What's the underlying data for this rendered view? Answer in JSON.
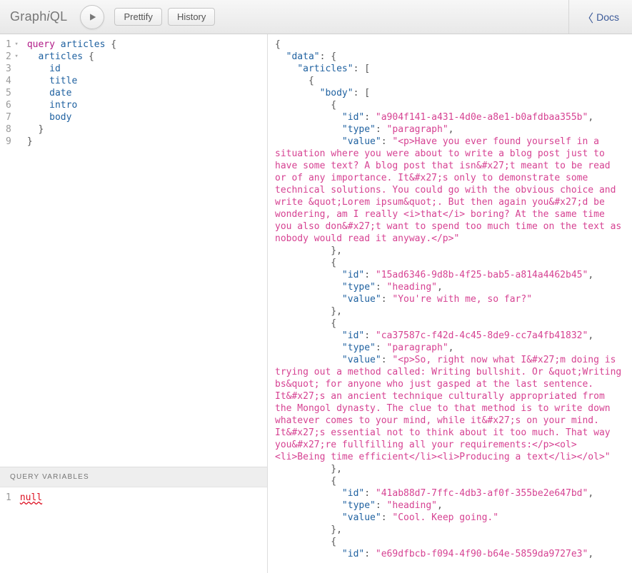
{
  "logo_prefix": "Graph",
  "logo_i": "i",
  "logo_suffix": "QL",
  "toolbar": {
    "prettify": "Prettify",
    "history": "History",
    "docs": "Docs"
  },
  "query": {
    "lines": [
      {
        "n": 1,
        "fold": true,
        "tokens": [
          [
            "kw",
            "query"
          ],
          [
            "",
            ""
          ],
          [
            "sp",
            " "
          ],
          [
            "def",
            "articles"
          ],
          [
            "sp",
            " "
          ],
          [
            "punc",
            "{"
          ]
        ]
      },
      {
        "n": 2,
        "fold": true,
        "tokens": [
          [
            "sp",
            "  "
          ],
          [
            "attr",
            "articles"
          ],
          [
            "sp",
            " "
          ],
          [
            "punc",
            "{"
          ]
        ]
      },
      {
        "n": 3,
        "tokens": [
          [
            "sp",
            "    "
          ],
          [
            "attr",
            "id"
          ]
        ]
      },
      {
        "n": 4,
        "tokens": [
          [
            "sp",
            "    "
          ],
          [
            "attr",
            "title"
          ]
        ]
      },
      {
        "n": 5,
        "tokens": [
          [
            "sp",
            "    "
          ],
          [
            "attr",
            "date"
          ]
        ]
      },
      {
        "n": 6,
        "tokens": [
          [
            "sp",
            "    "
          ],
          [
            "attr",
            "intro"
          ]
        ]
      },
      {
        "n": 7,
        "tokens": [
          [
            "sp",
            "    "
          ],
          [
            "attr",
            "body"
          ]
        ]
      },
      {
        "n": 8,
        "tokens": [
          [
            "sp",
            "  "
          ],
          [
            "punc",
            "}"
          ]
        ]
      },
      {
        "n": 9,
        "tokens": [
          [
            "punc",
            "}"
          ]
        ]
      }
    ]
  },
  "variables": {
    "header": "Query Variables",
    "line_no": "1",
    "value": "null"
  },
  "result_rows": [
    {
      "indent": 0,
      "parts": [
        [
          "punc",
          "{"
        ]
      ]
    },
    {
      "indent": 1,
      "parts": [
        [
          "key",
          "\"data\""
        ],
        [
          "punc",
          ": {"
        ]
      ]
    },
    {
      "indent": 2,
      "parts": [
        [
          "key",
          "\"articles\""
        ],
        [
          "punc",
          ": ["
        ]
      ]
    },
    {
      "indent": 3,
      "parts": [
        [
          "punc",
          "{"
        ]
      ]
    },
    {
      "indent": 4,
      "parts": [
        [
          "key",
          "\"body\""
        ],
        [
          "punc",
          ": ["
        ]
      ]
    },
    {
      "indent": 5,
      "parts": [
        [
          "punc",
          "{"
        ]
      ]
    },
    {
      "indent": 6,
      "parts": [
        [
          "key",
          "\"id\""
        ],
        [
          "punc",
          ": "
        ],
        [
          "str",
          "\"a904f141-a431-4d0e-a8e1-b0afdbaa355b\""
        ],
        [
          "punc",
          ","
        ]
      ]
    },
    {
      "indent": 6,
      "parts": [
        [
          "key",
          "\"type\""
        ],
        [
          "punc",
          ": "
        ],
        [
          "str",
          "\"paragraph\""
        ],
        [
          "punc",
          ","
        ]
      ]
    },
    {
      "indent": 6,
      "wrap": true,
      "parts": [
        [
          "key",
          "\"value\""
        ],
        [
          "punc",
          ": "
        ],
        [
          "str",
          "\"<p>Have you ever found yourself in a situation where you were about to write a blog post just to have some text? A blog post that isn&#x27;t meant to be read or of any importance. It&#x27;s only to demonstrate some technical solutions. You could go with the obvious choice and write &quot;Lorem ipsum&quot;. But then again you&#x27;d be wondering, am I really <i>that</i> boring? At the same time you also don&#x27;t want to spend too much time on the text as nobody would read it anyway.</p>\""
        ]
      ]
    },
    {
      "indent": 5,
      "parts": [
        [
          "punc",
          "},"
        ]
      ]
    },
    {
      "indent": 5,
      "parts": [
        [
          "punc",
          "{"
        ]
      ]
    },
    {
      "indent": 6,
      "parts": [
        [
          "key",
          "\"id\""
        ],
        [
          "punc",
          ": "
        ],
        [
          "str",
          "\"15ad6346-9d8b-4f25-bab5-a814a4462b45\""
        ],
        [
          "punc",
          ","
        ]
      ]
    },
    {
      "indent": 6,
      "parts": [
        [
          "key",
          "\"type\""
        ],
        [
          "punc",
          ": "
        ],
        [
          "str",
          "\"heading\""
        ],
        [
          "punc",
          ","
        ]
      ]
    },
    {
      "indent": 6,
      "parts": [
        [
          "key",
          "\"value\""
        ],
        [
          "punc",
          ": "
        ],
        [
          "str",
          "\"You're with me, so far?\""
        ]
      ]
    },
    {
      "indent": 5,
      "parts": [
        [
          "punc",
          "},"
        ]
      ]
    },
    {
      "indent": 5,
      "parts": [
        [
          "punc",
          "{"
        ]
      ]
    },
    {
      "indent": 6,
      "parts": [
        [
          "key",
          "\"id\""
        ],
        [
          "punc",
          ": "
        ],
        [
          "str",
          "\"ca37587c-f42d-4c45-8de9-cc7a4fb41832\""
        ],
        [
          "punc",
          ","
        ]
      ]
    },
    {
      "indent": 6,
      "parts": [
        [
          "key",
          "\"type\""
        ],
        [
          "punc",
          ": "
        ],
        [
          "str",
          "\"paragraph\""
        ],
        [
          "punc",
          ","
        ]
      ]
    },
    {
      "indent": 6,
      "wrap": true,
      "parts": [
        [
          "key",
          "\"value\""
        ],
        [
          "punc",
          ": "
        ],
        [
          "str",
          "\"<p>So, right now what I&#x27;m doing is trying out a method called: Writing bullshit. Or &quot;Writing bs&quot; for anyone who just gasped at the last sentence. It&#x27;s an ancient technique culturally appropriated from the Mongol dynasty. The clue to that method is to write down whatever comes to your mind, while it&#x27;s on your mind. It&#x27;s essential not to think about it too much. That way you&#x27;re fullfilling all your requirements:</p><ol><li>Being time efficient</li><li>Producing a text</li></ol>\""
        ]
      ]
    },
    {
      "indent": 5,
      "parts": [
        [
          "punc",
          "},"
        ]
      ]
    },
    {
      "indent": 5,
      "parts": [
        [
          "punc",
          "{"
        ]
      ]
    },
    {
      "indent": 6,
      "parts": [
        [
          "key",
          "\"id\""
        ],
        [
          "punc",
          ": "
        ],
        [
          "str",
          "\"41ab88d7-7ffc-4db3-af0f-355be2e647bd\""
        ],
        [
          "punc",
          ","
        ]
      ]
    },
    {
      "indent": 6,
      "parts": [
        [
          "key",
          "\"type\""
        ],
        [
          "punc",
          ": "
        ],
        [
          "str",
          "\"heading\""
        ],
        [
          "punc",
          ","
        ]
      ]
    },
    {
      "indent": 6,
      "parts": [
        [
          "key",
          "\"value\""
        ],
        [
          "punc",
          ": "
        ],
        [
          "str",
          "\"Cool. Keep going.\""
        ]
      ]
    },
    {
      "indent": 5,
      "parts": [
        [
          "punc",
          "},"
        ]
      ]
    },
    {
      "indent": 5,
      "parts": [
        [
          "punc",
          "{"
        ]
      ]
    },
    {
      "indent": 6,
      "parts": [
        [
          "key",
          "\"id\""
        ],
        [
          "punc",
          ": "
        ],
        [
          "str",
          "\"e69dfbcb-f094-4f90-b64e-5859da9727e3\""
        ],
        [
          "punc",
          ","
        ]
      ]
    }
  ]
}
